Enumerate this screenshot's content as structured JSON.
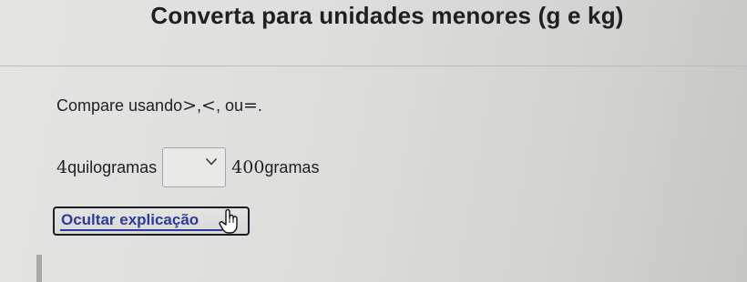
{
  "title": "Converta para unidades menores (g e kg)",
  "instruction": {
    "prefix": "Compare usando ",
    "gt": ">",
    "sep1": ", ",
    "lt": "<",
    "sep2": ", ou ",
    "eq": "=",
    "end": "."
  },
  "problem": {
    "left_value": "4",
    "left_unit": " quilogramas",
    "right_value": "400",
    "right_unit": " gramas",
    "dropdown_selected": ""
  },
  "buttons": {
    "explanation_label": "Ocultar explicação"
  },
  "icons": {
    "dropdown": "chevron-down-icon",
    "cursor": "hand-pointer-icon"
  },
  "colors": {
    "link": "#2d3a9c",
    "text": "#1f1f22"
  }
}
